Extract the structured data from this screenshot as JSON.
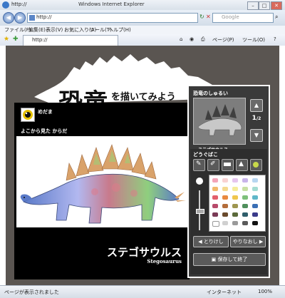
{
  "browser": {
    "title_url": "http://",
    "window_title": "Windows Internet Explorer",
    "address_value": "http://",
    "search_placeholder": "Google",
    "tab_title": "http://",
    "menu": [
      "ファイル(F)",
      "編集(E)",
      "表示(V)",
      "お気に入り(A)",
      "ツール(T)",
      "ヘルプ(H)"
    ],
    "toolbar_page": "ページ(P)",
    "toolbar_tools": "ツール(O)",
    "status_text": "ページが表示されました",
    "zone_text": "インターネット",
    "zoom_text": "100%"
  },
  "game": {
    "title_kanji": "恐竜",
    "title_sub": "を描いてみよう",
    "canvas": {
      "eye_label": "めだま",
      "top_label": "よこから見た からだ",
      "dino_name_jp": "ステゴサウルス",
      "dino_name_en": "Stegosaurus"
    },
    "selector": {
      "label": "恐竜のしゅるい",
      "thumb_name": "ステゴサウルス",
      "page_current": "1",
      "page_total": "2"
    },
    "tools": {
      "label": "どうぐばこ",
      "undo_label": "とりけし",
      "redo_label": "やりなおし",
      "save_label": "保存して終了"
    },
    "palette_colors": [
      "#f4a4b8",
      "#f9d2d2",
      "#e6c5ee",
      "#c9b4ea",
      "#b7d6f0",
      "#f1b86b",
      "#f4d98f",
      "#f5ec9a",
      "#c9e0a3",
      "#a3dcd2",
      "#e35f6b",
      "#e9893f",
      "#f0c64c",
      "#7ec07a",
      "#5fb7c9",
      "#b84a6a",
      "#b46d3a",
      "#9e9650",
      "#4f8f5c",
      "#3a6fb5",
      "#7a3b56",
      "#6a4a2c",
      "#5b6a3a",
      "#2f5e6b",
      "#3a3a8a",
      "#ffffff",
      "#d0d0d0",
      "#9a9a9a",
      "#5a5a5a",
      "#111111"
    ]
  }
}
